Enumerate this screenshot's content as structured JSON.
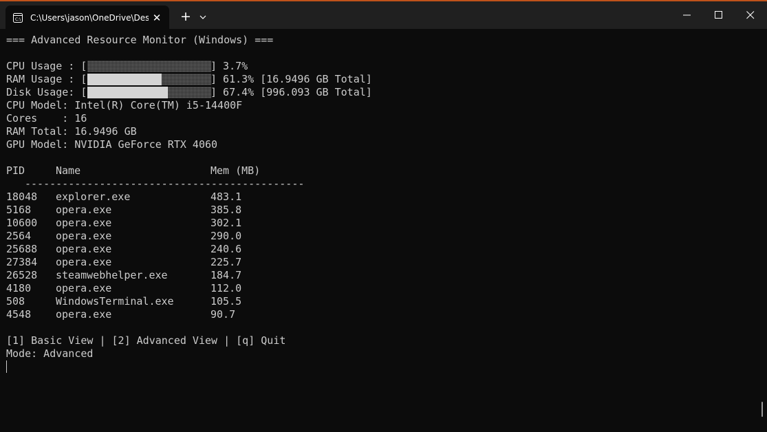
{
  "window": {
    "tab_title": "C:\\Users\\jason\\OneDrive\\Desl",
    "tab_close": "✕",
    "new_tab": "+",
    "accent_color": "#c0521a"
  },
  "terminal": {
    "header": "=== Advanced Resource Monitor (Windows) ===",
    "cpu_label": "CPU Usage : [",
    "cpu_value": "] 3.7%",
    "cpu_usage_percent": 3.7,
    "ram_label": "RAM Usage : [",
    "ram_value": "] 61.3% [16.9496 GB Total]",
    "ram_usage_percent": 61.3,
    "disk_label": "Disk Usage: [",
    "disk_value": "] 67.4% [996.093 GB Total]",
    "disk_usage_percent": 67.4,
    "cpu_model": "CPU Model: Intel(R) Core(TM) i5-14400F",
    "cores": "Cores    : 16",
    "ram_total": "RAM Total: 16.9496 GB",
    "gpu_model": "GPU Model: NVIDIA GeForce RTX 4060",
    "table_headers": {
      "pid": "PID",
      "name": "Name",
      "mem": "Mem (MB)"
    },
    "table_separator": "---------------------------------------------",
    "processes": [
      {
        "pid": "18048",
        "name": "explorer.exe",
        "mem": "483.1"
      },
      {
        "pid": "5168",
        "name": "opera.exe",
        "mem": "385.8"
      },
      {
        "pid": "10600",
        "name": "opera.exe",
        "mem": "302.1"
      },
      {
        "pid": "2564",
        "name": "opera.exe",
        "mem": "290.0"
      },
      {
        "pid": "25688",
        "name": "opera.exe",
        "mem": "240.6"
      },
      {
        "pid": "27384",
        "name": "opera.exe",
        "mem": "225.7"
      },
      {
        "pid": "26528",
        "name": "steamwebhelper.exe",
        "mem": "184.7"
      },
      {
        "pid": "4180",
        "name": "opera.exe",
        "mem": "112.0"
      },
      {
        "pid": "508",
        "name": "WindowsTerminal.exe",
        "mem": "105.5"
      },
      {
        "pid": "4548",
        "name": "opera.exe",
        "mem": "90.7"
      }
    ],
    "menu": "[1] Basic View | [2] Advanced View | [q] Quit",
    "mode": "Mode: Advanced"
  }
}
